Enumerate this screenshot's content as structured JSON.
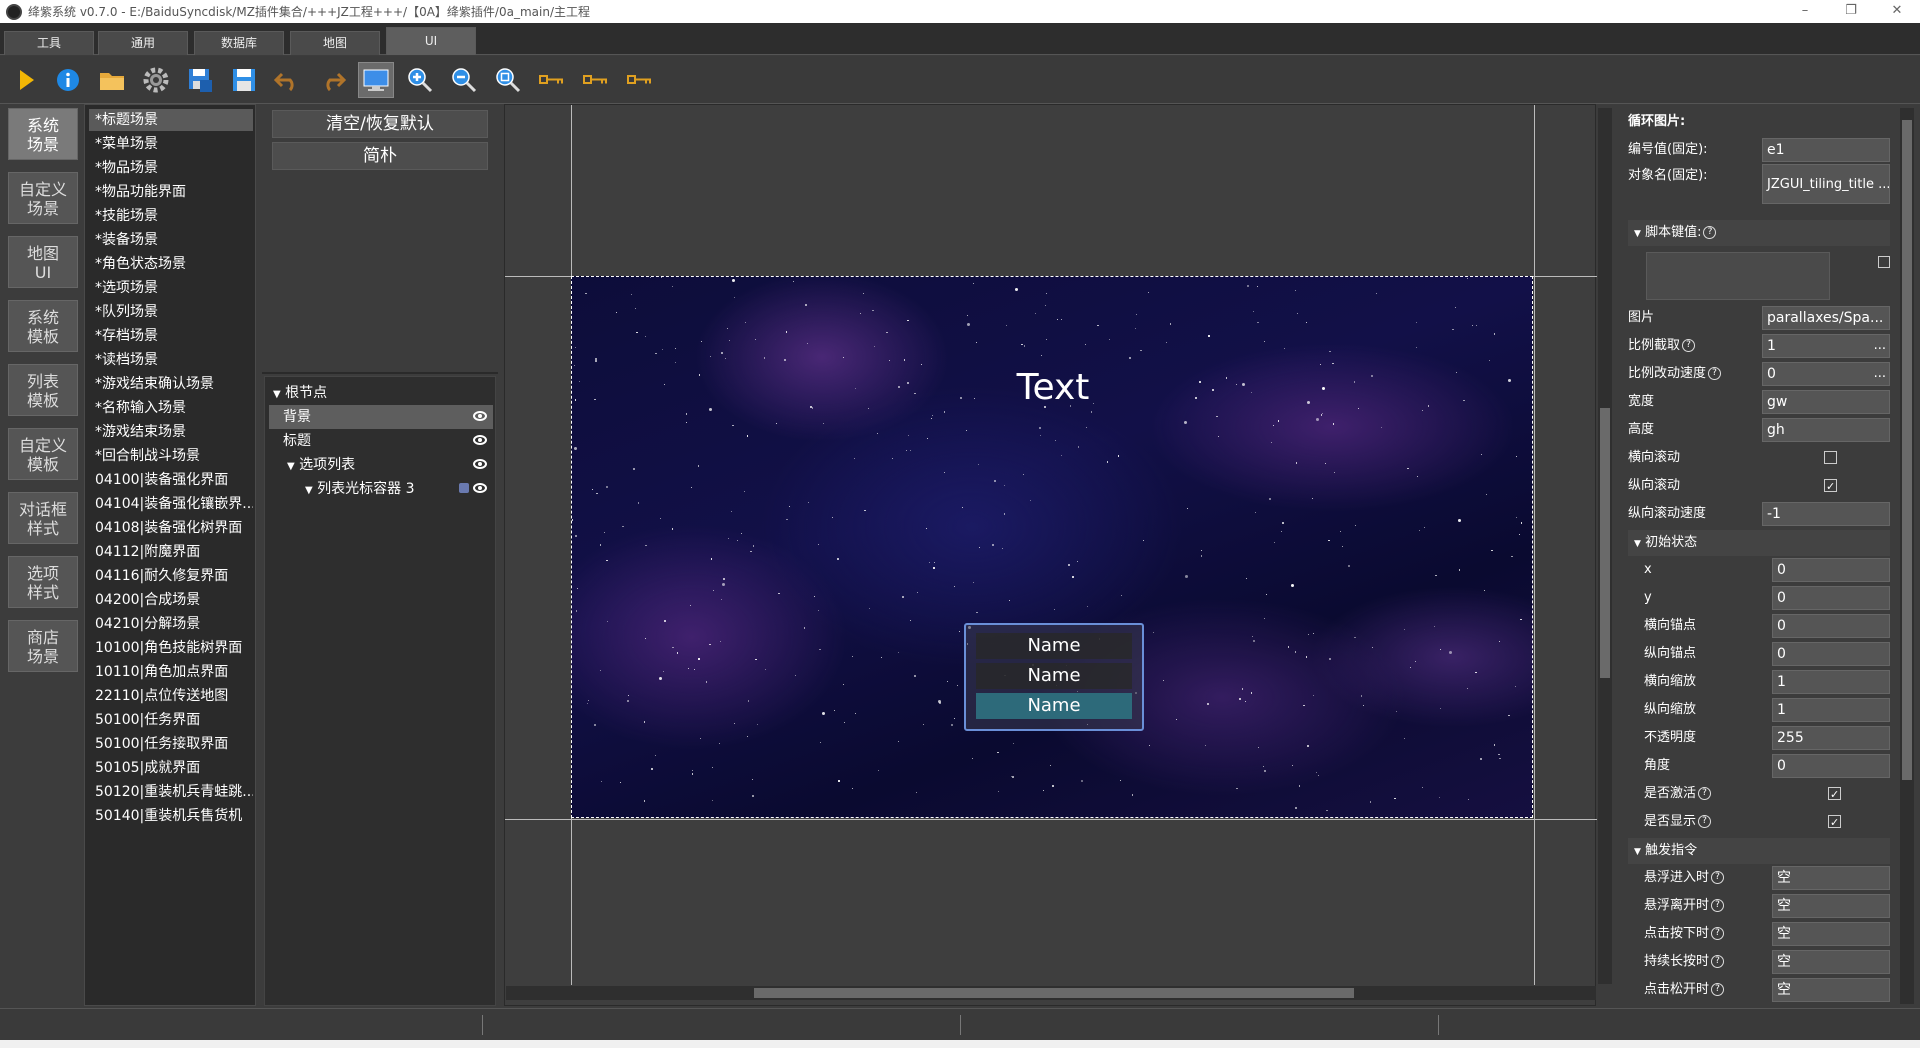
{
  "window": {
    "title": "绛紫系统 v0.7.0 - E:/BaiduSyncdisk/MZ插件集合/+++JZ工程+++/【0A】绛紫插件/0a_main/主工程",
    "minimize": "–",
    "restore": "❐",
    "close": "✕"
  },
  "tabs": [
    "工具",
    "通用",
    "数据库",
    "地图",
    "UI"
  ],
  "left_nav": [
    {
      "label": "系统\n场景"
    },
    {
      "label": "自定义\n场景"
    },
    {
      "label": "地图\nUI"
    },
    {
      "label": "系统\n模板"
    },
    {
      "label": "列表\n模板"
    },
    {
      "label": "自定义\n模板"
    },
    {
      "label": "对话框\n样式"
    },
    {
      "label": "选项\n样式"
    },
    {
      "label": "商店\n场景"
    }
  ],
  "scenes": [
    "*标题场景",
    "*菜单场景",
    "*物品场景",
    "*物品功能界面",
    "*技能场景",
    "*装备场景",
    "*角色状态场景",
    "*选项场景",
    "*队列场景",
    "*存档场景",
    "*读档场景",
    "*游戏结束确认场景",
    "*名称输入场景",
    "*游戏结束场景",
    "*回合制战斗场景",
    "04100|装备强化界面",
    "04104|装备强化镶嵌界...",
    "04108|装备强化树界面",
    "04112|附魔界面",
    "04116|耐久修复界面",
    "04200|合成场景",
    "04210|分解场景",
    "10100|角色技能树界面",
    "10110|角色加点界面",
    "22110|点位传送地图",
    "50100|任务界面",
    "50100|任务接取界面",
    "50105|成就界面",
    "50120|重装机兵青蛙跳...",
    "50140|重装机兵售货机"
  ],
  "mid_buttons": {
    "reset": "清空/恢复默认",
    "simple": "简朴"
  },
  "tree": [
    {
      "label": "根节点"
    },
    {
      "label": "背景"
    },
    {
      "label": "标题"
    },
    {
      "label": "选项列表"
    },
    {
      "label": "列表光标容器 3"
    }
  ],
  "stage": {
    "title_text": "Text",
    "menu_items": [
      "Name",
      "Name",
      "Name"
    ]
  },
  "props": {
    "header": "循环图片:",
    "id_label": "编号值(固定):",
    "id_value": "e1",
    "obj_label": "对象名(固定):",
    "obj_value": "JZGUI_tiling_title ...",
    "script_section": "脚本键值:",
    "image_label": "图片",
    "image_value": "parallaxes/Spa...",
    "ratio_crop_label": "比例截取",
    "ratio_crop_value": "1",
    "ratio_speed_label": "比例改动速度",
    "ratio_speed_value": "0",
    "width_label": "宽度",
    "width_value": "gw",
    "height_label": "高度",
    "height_value": "gh",
    "hscroll_label": "横向滚动",
    "vscroll_label": "纵向滚动",
    "vspeed_label": "纵向滚动速度",
    "vspeed_value": "-1",
    "init_section": "初始状态",
    "x_label": "x",
    "x_value": "0",
    "y_label": "y",
    "y_value": "0",
    "hanchor_label": "横向锚点",
    "hanchor_value": "0",
    "vanchor_label": "纵向锚点",
    "vanchor_value": "0",
    "hscale_label": "横向缩放",
    "hscale_value": "1",
    "vscale_label": "纵向缩放",
    "vscale_value": "1",
    "opacity_label": "不透明度",
    "opacity_value": "255",
    "angle_label": "角度",
    "angle_value": "0",
    "active_label": "是否激活",
    "visible_label": "是否显示",
    "trigger_section": "触发指令",
    "hover_in_label": "悬浮进入时",
    "hover_in_value": "空",
    "hover_out_label": "悬浮离开时",
    "hover_out_value": "空",
    "press_label": "点击按下时",
    "press_value": "空",
    "longpress_label": "持续长按时",
    "longpress_value": "空",
    "release_label": "点击松开时",
    "release_value": "空",
    "dots": "..."
  }
}
